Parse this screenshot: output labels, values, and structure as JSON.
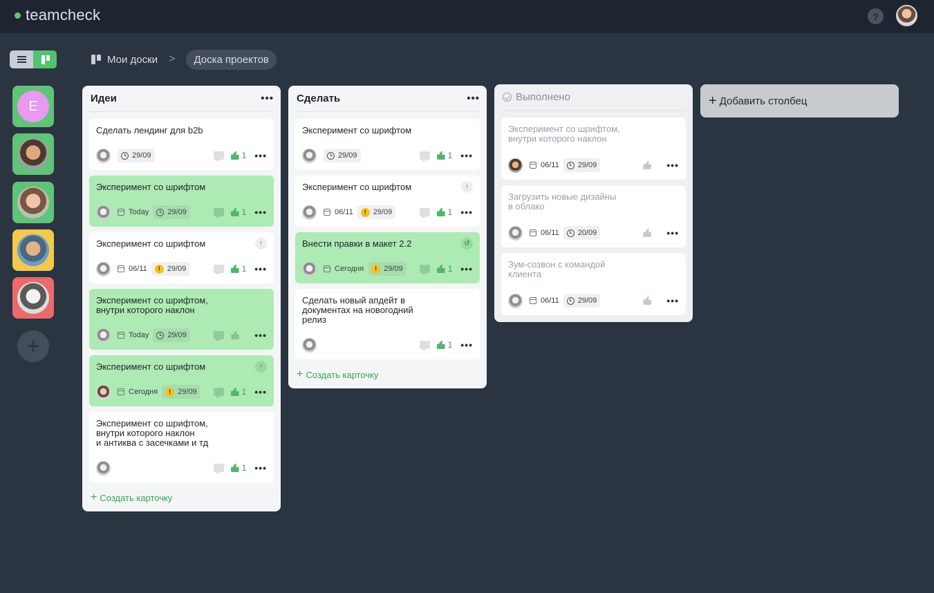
{
  "app": {
    "logo": "teamcheck",
    "help": "?"
  },
  "breadcrumb": {
    "root": "Мои доски",
    "separator": ">",
    "current": "Доска проектов"
  },
  "teams": [
    {
      "letter": "E",
      "bg": "#5fc378"
    },
    {
      "letter": "",
      "bg": "#5fc378"
    },
    {
      "letter": "",
      "bg": "#5fc378"
    },
    {
      "letter": "",
      "bg": "#f2c94c"
    },
    {
      "letter": "",
      "bg": "#eb6b6b"
    }
  ],
  "columns": {
    "ideas": {
      "title": "Идеи",
      "create_label": "Создать карточку",
      "cards": [
        {
          "title": "Сделать лендинг для b2b",
          "green": false,
          "plan": "",
          "due": "29/09",
          "warn": false,
          "likes": "1",
          "corner": ""
        },
        {
          "title": "Эксперимент со шрифтом",
          "green": true,
          "plan": "Today",
          "due": "29/09",
          "warn": false,
          "likes": "1",
          "corner": ""
        },
        {
          "title": "Эксперимент со шрифтом",
          "green": false,
          "plan": "06/11",
          "due": "29/09",
          "warn": true,
          "likes": "1",
          "corner": "↑"
        },
        {
          "title": "Эксперимент со шрифтом,\nвнутри которого наклон",
          "green": true,
          "plan": "Today",
          "due": "29/09",
          "warn": false,
          "likes": "",
          "corner": ""
        },
        {
          "title": "Эксперимент со шрифтом",
          "green": true,
          "plan": "Сегодня",
          "due": "29/09",
          "warn": true,
          "likes": "1",
          "corner": "↑"
        },
        {
          "title": "Эксперимент со шрифтом,\nвнутри которого наклон\nи антиква с засечками и тд",
          "green": false,
          "plan": "",
          "due": "",
          "warn": false,
          "likes": "1",
          "corner": ""
        }
      ]
    },
    "todo": {
      "title": "Сделать",
      "create_label": "Создать карточку",
      "cards": [
        {
          "title": "Эксперимент со шрифтом",
          "green": false,
          "plan": "",
          "due": "29/09",
          "warn": false,
          "likes": "1",
          "corner": ""
        },
        {
          "title": "Эксперимент со шрифтом",
          "green": false,
          "plan": "06/11",
          "due": "29/09",
          "warn": true,
          "likes": "1",
          "corner": "↑"
        },
        {
          "title": "Внести правки в макет 2.2",
          "green": true,
          "plan": "Сегодня",
          "due": "29/09",
          "warn": true,
          "likes": "1",
          "corner": "↺"
        },
        {
          "title": "Сделать новый апдейт в\nдокументах на новогодний\nрелиз",
          "green": false,
          "plan": "",
          "due": "",
          "warn": false,
          "likes": "1",
          "corner": ""
        }
      ]
    },
    "done": {
      "title": "Выполнено",
      "cards": [
        {
          "title": "Эксперимент со шрифтом,\nвнутри которого наклон",
          "plan": "06/11",
          "due": "29/09"
        },
        {
          "title": "Загрузить новые дизайны\nв облако",
          "plan": "06/11",
          "due": "20/09"
        },
        {
          "title": "Зум-созвон с командой\nклиента",
          "plan": "06/11",
          "due": "29/09"
        }
      ]
    }
  },
  "add_column_label": "Добавить столбец",
  "colors": {
    "accent": "#54c072",
    "card_green": "#aeeab3",
    "background": "#2b3441",
    "topbar": "#1e2530"
  }
}
